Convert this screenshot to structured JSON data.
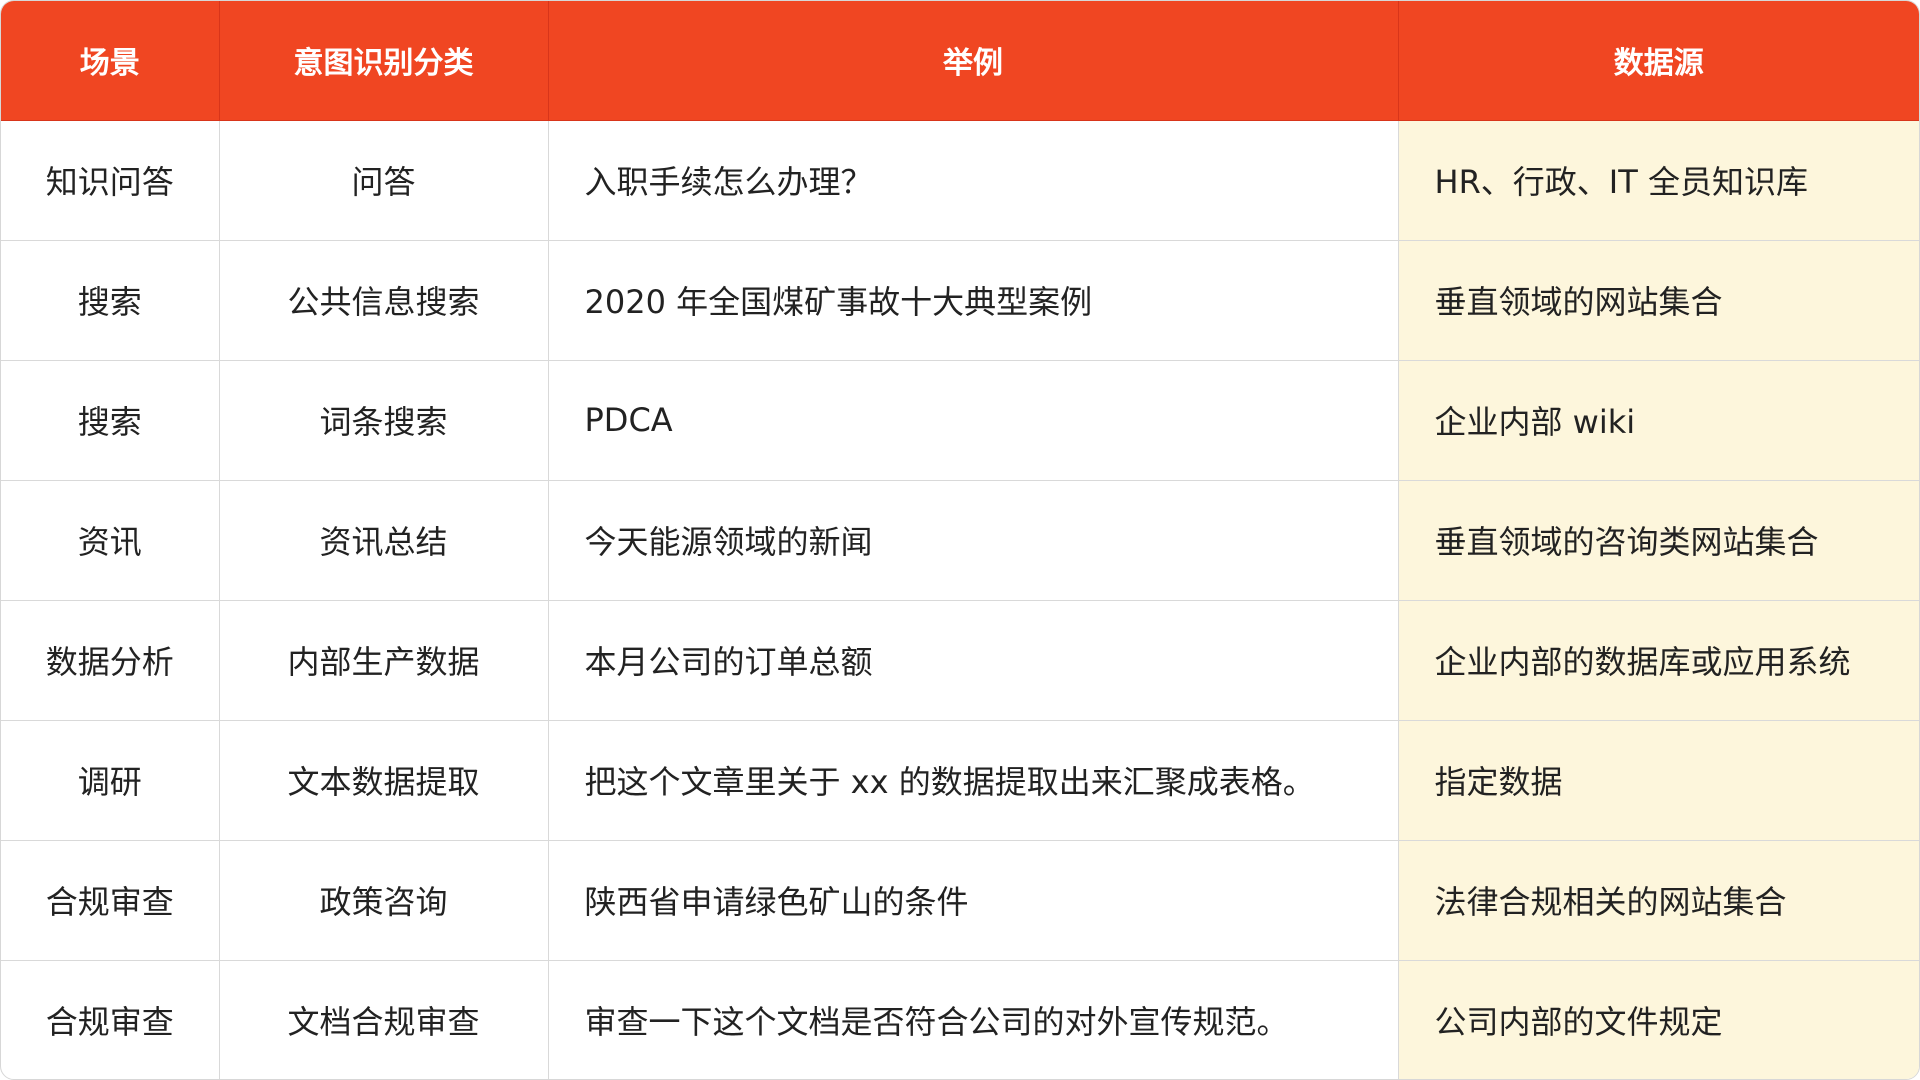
{
  "headers": {
    "scene": "场景",
    "intent": "意图识别分类",
    "example": "举例",
    "source": "数据源"
  },
  "rows": [
    {
      "scene": "知识问答",
      "intent": "问答",
      "example": "入职手续怎么办理？",
      "source": "HR、行政、IT 全员知识库"
    },
    {
      "scene": "搜索",
      "intent": "公共信息搜索",
      "example": "2020 年全国煤矿事故十大典型案例",
      "source": "垂直领域的网站集合"
    },
    {
      "scene": "搜索",
      "intent": "词条搜索",
      "example": "PDCA",
      "source": "企业内部 wiki"
    },
    {
      "scene": "资讯",
      "intent": "资讯总结",
      "example": "今天能源领域的新闻",
      "source": "垂直领域的咨询类网站集合"
    },
    {
      "scene": "数据分析",
      "intent": "内部生产数据",
      "example": "本月公司的订单总额",
      "source": "企业内部的数据库或应用系统"
    },
    {
      "scene": "调研",
      "intent": "文本数据提取",
      "example": "把这个文章里关于 xx 的数据提取出来汇聚成表格。",
      "source": "指定数据"
    },
    {
      "scene": "合规审查",
      "intent": "政策咨询",
      "example": "陕西省申请绿色矿山的条件",
      "source": "法律合规相关的网站集合"
    },
    {
      "scene": "合规审查",
      "intent": "文档合规审查",
      "example": "审查一下这个文档是否符合公司的对外宣传规范。",
      "source": "公司内部的文件规定"
    }
  ],
  "colors": {
    "header_bg": "#f04622",
    "header_text": "#ffffff",
    "source_column_bg": "#fdf6dc",
    "grid_line": "#d9d9d9"
  }
}
